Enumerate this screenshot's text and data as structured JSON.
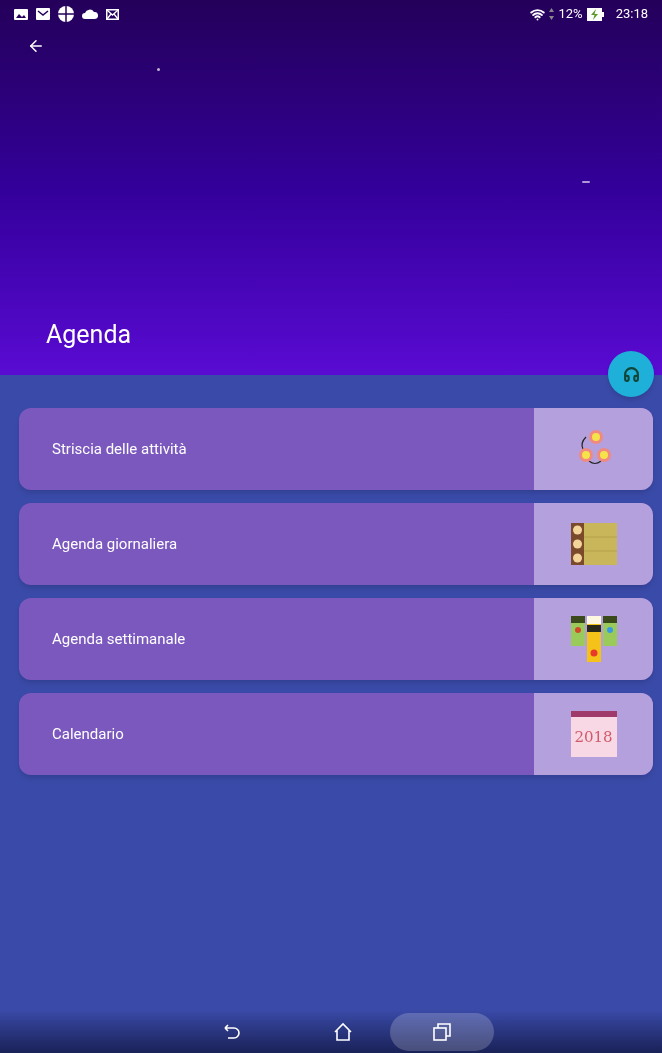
{
  "status_bar": {
    "battery": "12%",
    "time": "23:18"
  },
  "header": {
    "title": "Agenda"
  },
  "items": [
    {
      "label": "Striscia delle attività",
      "kind": "steps"
    },
    {
      "label": "Agenda giornaliera",
      "kind": "daily"
    },
    {
      "label": "Agenda settimanale",
      "kind": "weekly"
    },
    {
      "label": "Calendario",
      "kind": "calendar",
      "icon_text": "2018"
    }
  ]
}
